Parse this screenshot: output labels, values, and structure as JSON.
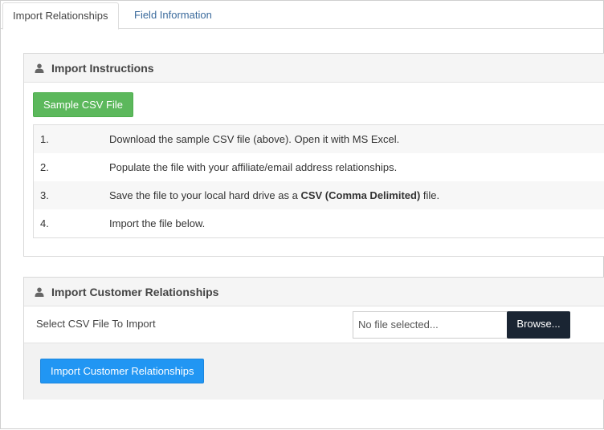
{
  "tabs": [
    {
      "label": "Import Relationships"
    },
    {
      "label": "Field Information"
    }
  ],
  "instructions": {
    "title": "Import Instructions",
    "sample_button": "Sample CSV File",
    "steps": [
      {
        "num": "1.",
        "text": "Download the sample CSV file (above). Open it with MS Excel."
      },
      {
        "num": "2.",
        "text": "Populate the file with your affiliate/email address relationships."
      },
      {
        "num": "3.",
        "text_before": "Save the file to your local hard drive as a ",
        "bold": "CSV (Comma Delimited)",
        "text_after": " file."
      },
      {
        "num": "4.",
        "text": "Import the file below."
      }
    ]
  },
  "customer_import": {
    "title": "Import Customer Relationships",
    "field_label": "Select CSV File To Import",
    "file_placeholder": "No file selected...",
    "browse_label": "Browse...",
    "submit_label": "Import Customer Relationships"
  },
  "icons": {
    "panel_header": "user-icon"
  }
}
